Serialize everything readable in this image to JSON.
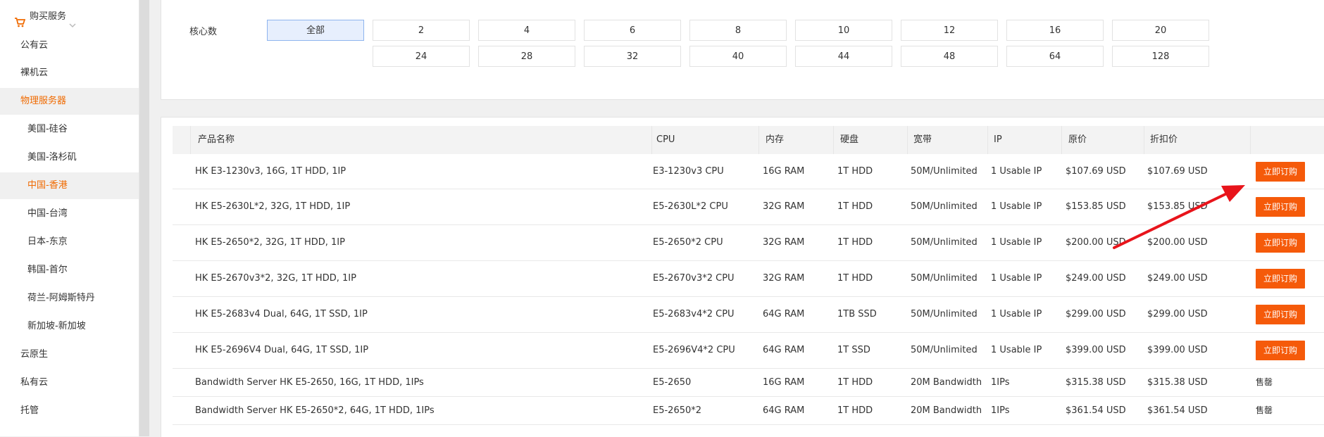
{
  "sidebar": {
    "header_label": "购买服务",
    "items": [
      {
        "label": "公有云",
        "level": "top",
        "active": false
      },
      {
        "label": "裸机云",
        "level": "top",
        "active": false
      },
      {
        "label": "物理服务器",
        "level": "top",
        "active": true
      },
      {
        "label": "美国-硅谷",
        "level": "sub",
        "active": false
      },
      {
        "label": "美国-洛杉矶",
        "level": "sub",
        "active": false
      },
      {
        "label": "中国-香港",
        "level": "sub",
        "active": true
      },
      {
        "label": "中国-台湾",
        "level": "sub",
        "active": false
      },
      {
        "label": "日本-东京",
        "level": "sub",
        "active": false
      },
      {
        "label": "韩国-首尔",
        "level": "sub",
        "active": false
      },
      {
        "label": "荷兰-阿姆斯特丹",
        "level": "sub",
        "active": false
      },
      {
        "label": "新加坡-新加坡",
        "level": "sub",
        "active": false
      },
      {
        "label": "云原生",
        "level": "top",
        "active": false
      },
      {
        "label": "私有云",
        "level": "top",
        "active": false
      },
      {
        "label": "托管",
        "level": "top",
        "active": false
      }
    ]
  },
  "filter": {
    "label": "核心数",
    "selected": "全部",
    "options_row1": [
      "全部",
      "2",
      "4",
      "6",
      "8",
      "10",
      "12",
      "16",
      "20"
    ],
    "options_row2": [
      "24",
      "28",
      "32",
      "40",
      "44",
      "48",
      "64",
      "128"
    ]
  },
  "table": {
    "headers": [
      "产品名称",
      "CPU",
      "内存",
      "硬盘",
      "宽带",
      "IP",
      "原价",
      "折扣价"
    ],
    "buy_label": "立即订购",
    "sold_label": "售罄",
    "rows": [
      {
        "name": "HK E3-1230v3, 16G, 1T HDD, 1IP",
        "cpu": "E3-1230v3 CPU",
        "ram": "16G RAM",
        "disk": "1T HDD",
        "bw": "50M/Unlimited",
        "ip": "1 Usable IP",
        "price": "$107.69 USD",
        "discount": "$107.69 USD",
        "status": "buy"
      },
      {
        "name": "HK E5-2630L*2, 32G, 1T HDD, 1IP",
        "cpu": "E5-2630L*2 CPU",
        "ram": "32G RAM",
        "disk": "1T HDD",
        "bw": "50M/Unlimited",
        "ip": "1 Usable IP",
        "price": "$153.85 USD",
        "discount": "$153.85 USD",
        "status": "buy"
      },
      {
        "name": "HK E5-2650*2, 32G, 1T HDD, 1IP",
        "cpu": "E5-2650*2 CPU",
        "ram": "32G RAM",
        "disk": "1T HDD",
        "bw": "50M/Unlimited",
        "ip": "1 Usable IP",
        "price": "$200.00 USD",
        "discount": "$200.00 USD",
        "status": "buy"
      },
      {
        "name": "HK E5-2670v3*2, 32G, 1T HDD, 1IP",
        "cpu": "E5-2670v3*2 CPU",
        "ram": "32G RAM",
        "disk": "1T HDD",
        "bw": "50M/Unlimited",
        "ip": "1 Usable IP",
        "price": "$249.00 USD",
        "discount": "$249.00 USD",
        "status": "buy"
      },
      {
        "name": "HK E5-2683v4 Dual, 64G, 1T SSD, 1IP",
        "cpu": "E5-2683v4*2 CPU",
        "ram": "64G RAM",
        "disk": "1TB SSD",
        "bw": "50M/Unlimited",
        "ip": "1 Usable IP",
        "price": "$299.00 USD",
        "discount": "$299.00 USD",
        "status": "buy"
      },
      {
        "name": "HK E5-2696V4 Dual, 64G, 1T SSD, 1IP",
        "cpu": "E5-2696V4*2 CPU",
        "ram": "64G RAM",
        "disk": "1T SSD",
        "bw": "50M/Unlimited",
        "ip": "1 Usable IP",
        "price": "$399.00 USD",
        "discount": "$399.00 USD",
        "status": "buy"
      },
      {
        "name": "Bandwidth Server HK E5-2650, 16G, 1T HDD, 1IPs",
        "cpu": "E5-2650",
        "ram": "16G RAM",
        "disk": "1T HDD",
        "bw": "20M Bandwidth",
        "ip": "1IPs",
        "price": "$315.38 USD",
        "discount": "$315.38 USD",
        "status": "sold"
      },
      {
        "name": "Bandwidth Server HK E5-2650*2, 64G, 1T HDD, 1IPs",
        "cpu": "E5-2650*2",
        "ram": "64G RAM",
        "disk": "1T HDD",
        "bw": "20M Bandwidth",
        "ip": "1IPs",
        "price": "$361.54 USD",
        "discount": "$361.54 USD",
        "status": "sold"
      }
    ]
  },
  "colors": {
    "accent": "#f06a00",
    "buy_button": "#f55a0a",
    "annotation_arrow": "#e8141b"
  },
  "icons": {
    "cart": "cart-icon",
    "chevron": "chevron-down-icon"
  }
}
